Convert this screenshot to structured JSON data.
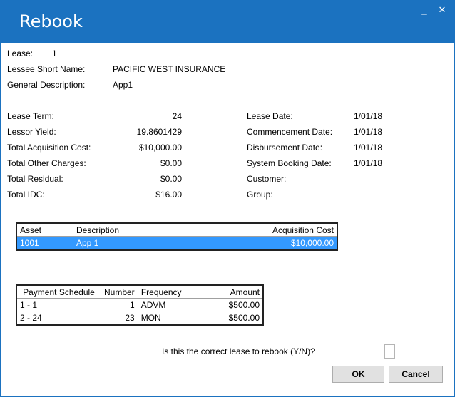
{
  "window": {
    "title": "Rebook",
    "minimize_glyph": "_",
    "close_glyph": "✕"
  },
  "header": {
    "lease_label": "Lease:",
    "lease_value": "1",
    "lessee_label": "Lessee Short Name:",
    "lessee_value": "PACIFIC WEST INSURANCE",
    "desc_label": "General Description:",
    "desc_value": "App1"
  },
  "left_fields": [
    {
      "label": "Lease Term:",
      "value": "24"
    },
    {
      "label": "Lessor Yield:",
      "value": "19.8601429"
    },
    {
      "label": "Total Acquisition Cost:",
      "value": "$10,000.00"
    },
    {
      "label": "Total Other Charges:",
      "value": "$0.00"
    },
    {
      "label": "Total Residual:",
      "value": "$0.00"
    },
    {
      "label": "Total IDC:",
      "value": "$16.00"
    }
  ],
  "right_fields": [
    {
      "label": "Lease Date:",
      "value": "1/01/18"
    },
    {
      "label": "Commencement Date:",
      "value": "1/01/18"
    },
    {
      "label": "Disbursement Date:",
      "value": "1/01/18"
    },
    {
      "label": "System Booking Date:",
      "value": "1/01/18"
    },
    {
      "label": "Customer:",
      "value": ""
    },
    {
      "label": "Group:",
      "value": ""
    }
  ],
  "asset_table": {
    "columns": [
      "Asset",
      "Description",
      "Acquisition Cost"
    ],
    "rows": [
      {
        "asset": "1001",
        "description": "App 1",
        "cost": "$10,000.00",
        "selected": true
      }
    ]
  },
  "schedule_table": {
    "columns": [
      "Payment Schedule",
      "Number",
      "Frequency",
      "Amount"
    ],
    "rows": [
      {
        "schedule": "1 -  1",
        "number": "1",
        "frequency": "ADVM",
        "amount": "$500.00"
      },
      {
        "schedule": "2 -  24",
        "number": "23",
        "frequency": "MON",
        "amount": "$500.00"
      }
    ]
  },
  "confirm": {
    "question": "Is this the correct lease to rebook (Y/N)?",
    "input_value": ""
  },
  "buttons": {
    "ok": "OK",
    "cancel": "Cancel"
  }
}
